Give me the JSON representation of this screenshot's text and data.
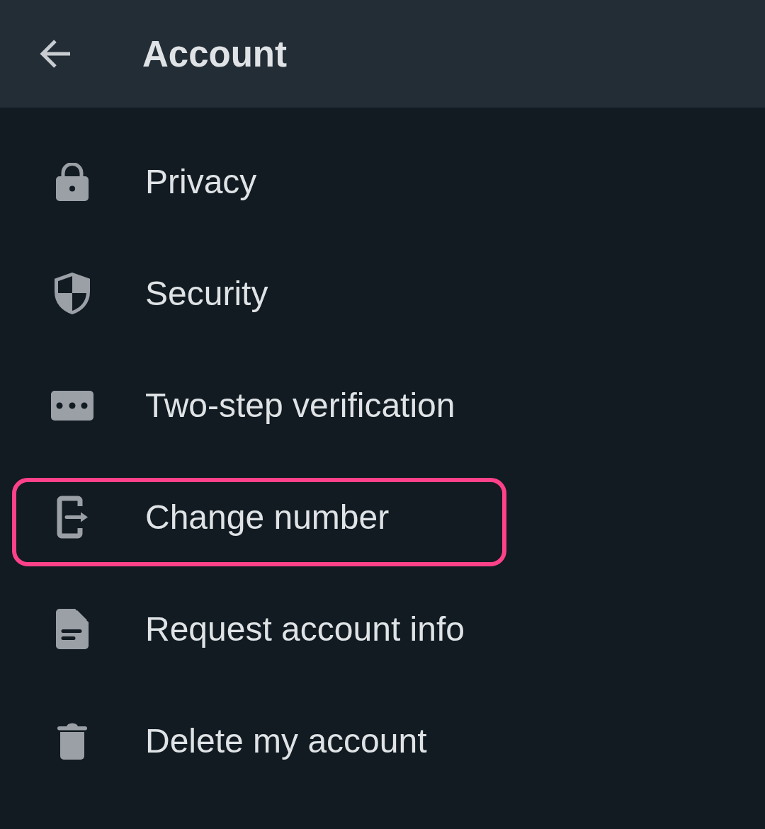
{
  "header": {
    "title": "Account"
  },
  "items": [
    {
      "label": "Privacy",
      "highlighted": false
    },
    {
      "label": "Security",
      "highlighted": false
    },
    {
      "label": "Two-step verification",
      "highlighted": false
    },
    {
      "label": "Change number",
      "highlighted": true
    },
    {
      "label": "Request account info",
      "highlighted": false
    },
    {
      "label": "Delete my account",
      "highlighted": false
    }
  ]
}
